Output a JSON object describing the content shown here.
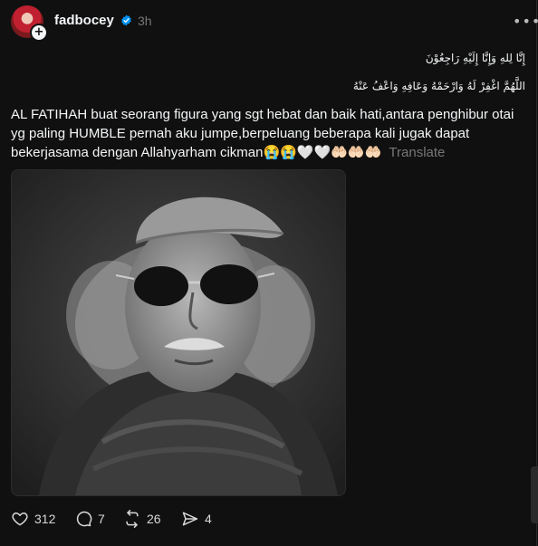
{
  "post": {
    "username": "fadbocey",
    "time": "3h",
    "arabic_line1": "إِنَّا لِلهِ وَإِنَّا إِلَيْهِ رَاجِعُوْنَ",
    "arabic_line2": "اللَّهُمَّ اغْفِرْ لَهُ وَارْحَمْهُ وَعَافِهِ وَاعْفُ عَنْهُ",
    "text": "AL FATIHAH buat seorang figura yang sgt hebat dan baik hati,antara penghibur otai yg paling HUMBLE pernah aku jumpe,berpeluang beberapa kali jugak dapat bekerjasama dengan Allahyarham cikman😭😭🤍🤍🤲🏻🤲🏻🤲🏻",
    "translate_label": "Translate"
  },
  "actions": {
    "likes": "312",
    "replies": "7",
    "reposts": "26",
    "shares": "4"
  },
  "icons": {
    "verified": "verified-badge-icon",
    "more": "more-horizontal-icon",
    "like": "heart-icon",
    "reply": "comment-bubble-icon",
    "repost": "repost-icon",
    "share": "send-icon"
  },
  "colors": {
    "background": "#101010",
    "text": "#f3f5f7",
    "muted": "#777777",
    "verified": "#0095f6"
  }
}
